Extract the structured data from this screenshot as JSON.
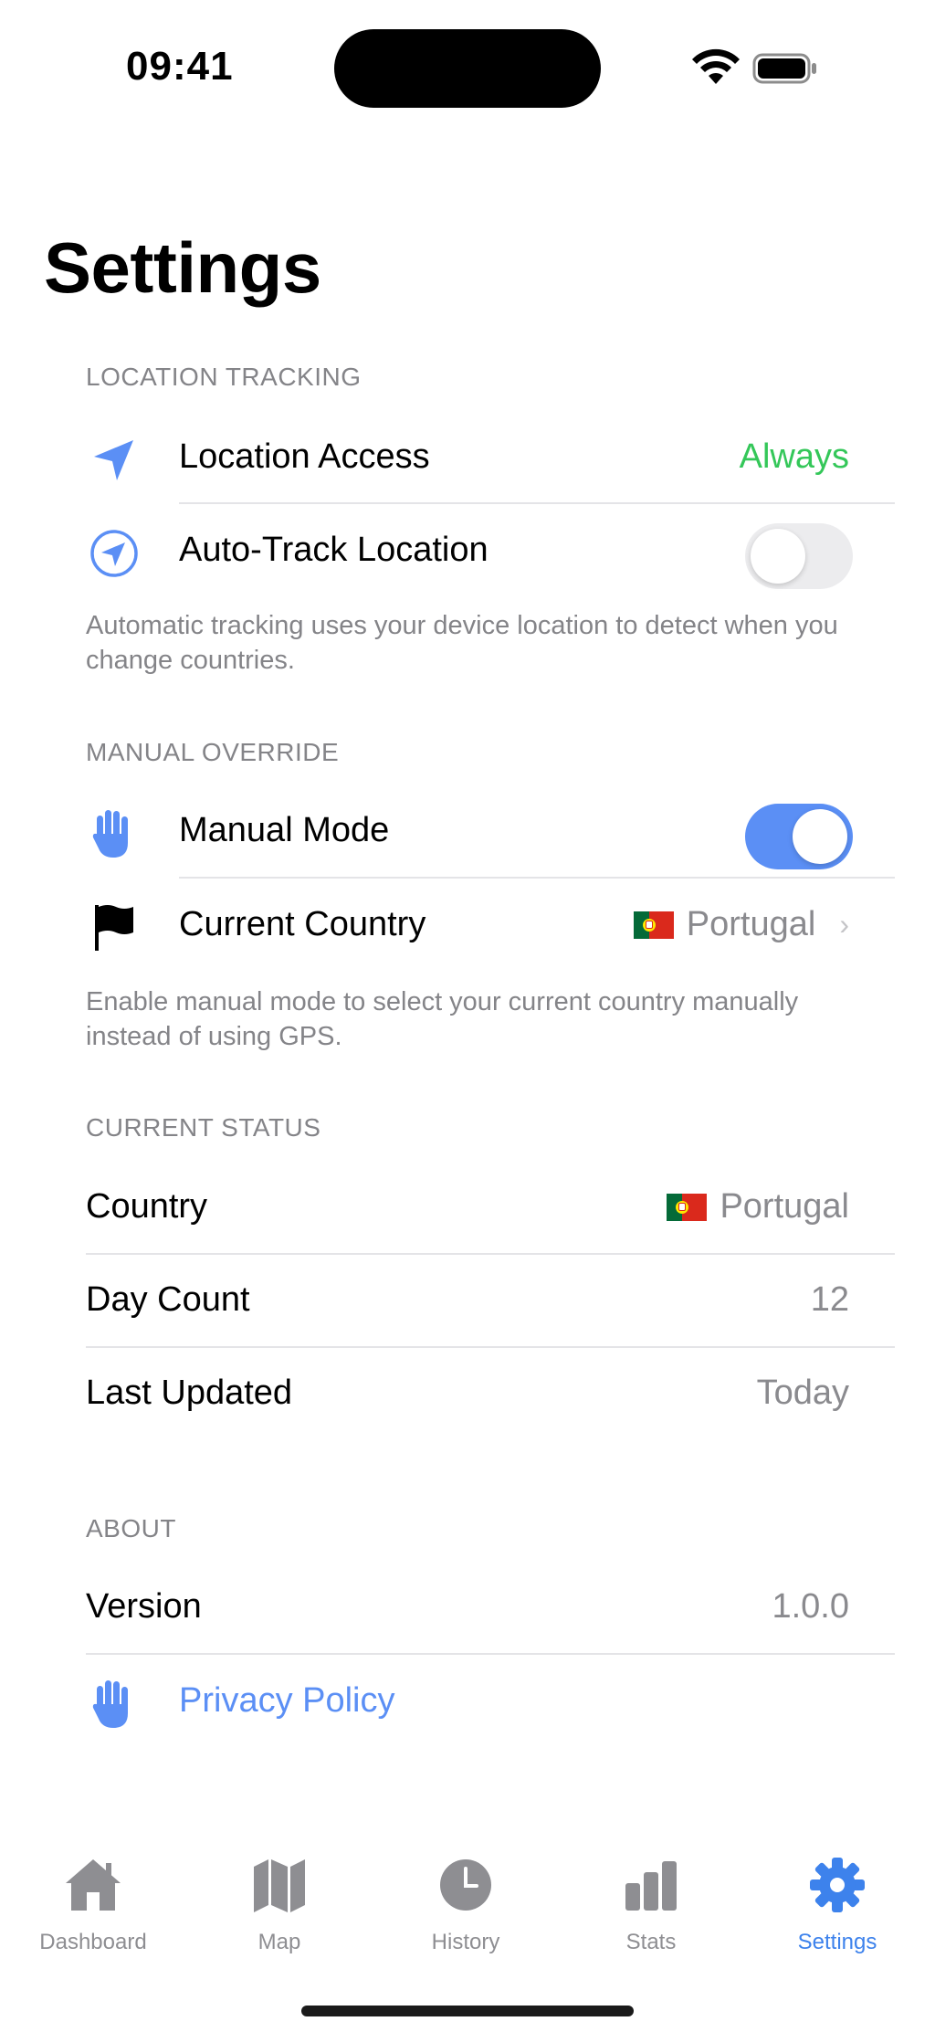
{
  "status_bar": {
    "time": "09:41"
  },
  "page": {
    "title": "Settings"
  },
  "sections": {
    "location": {
      "header": "LOCATION TRACKING",
      "location_access": {
        "label": "Location Access",
        "value": "Always"
      },
      "auto_track": {
        "label": "Auto-Track Location",
        "enabled": false
      },
      "footer": "Automatic tracking uses your device location to detect when you change countries."
    },
    "manual": {
      "header": "MANUAL OVERRIDE",
      "manual_mode": {
        "label": "Manual Mode",
        "enabled": true
      },
      "current_country": {
        "label": "Current Country",
        "value": "Portugal"
      },
      "footer": "Enable manual mode to select your current country manually instead of using GPS."
    },
    "status": {
      "header": "CURRENT STATUS",
      "country": {
        "label": "Country",
        "value": "Portugal"
      },
      "day_count": {
        "label": "Day Count",
        "value": "12"
      },
      "last_updated": {
        "label": "Last Updated",
        "value": "Today"
      }
    },
    "about": {
      "header": "ABOUT",
      "version": {
        "label": "Version",
        "value": "1.0.0"
      },
      "privacy": {
        "label": "Privacy Policy"
      }
    }
  },
  "tabs": [
    {
      "label": "Dashboard",
      "icon": "house-icon"
    },
    {
      "label": "Map",
      "icon": "map-icon"
    },
    {
      "label": "History",
      "icon": "clock-icon"
    },
    {
      "label": "Stats",
      "icon": "bar-chart-icon"
    },
    {
      "label": "Settings",
      "icon": "gear-icon",
      "active": true
    }
  ],
  "colors": {
    "accent": "#5b8ff5",
    "success": "#34c759",
    "secondary_text": "#8a8a8e",
    "tab_active": "#3d82ec"
  }
}
